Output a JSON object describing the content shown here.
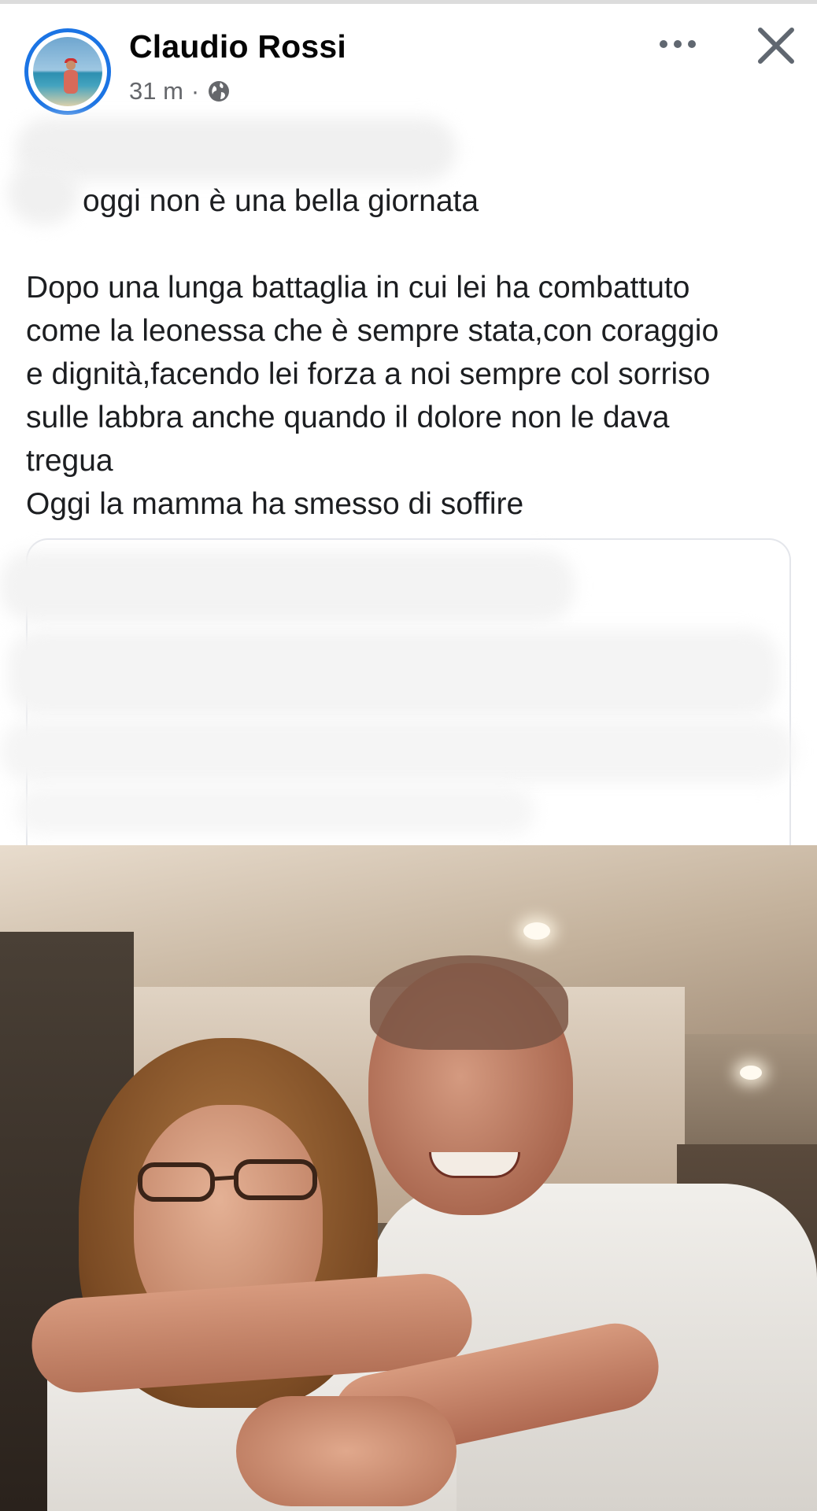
{
  "post": {
    "author": "Claudio Rossi",
    "time": "31 m",
    "separator": "·",
    "audience_icon": "globe-icon",
    "first_line": "oggi non è una bella giornata",
    "body": [
      "Dopo una lunga battaglia in cui lei ha combattuto",
      "come la leonessa che è sempre stata,con coraggio",
      "e dignità,facendo lei forza a noi sempre col sorriso",
      "sulle labbra anche quando il dolore non le dava",
      "tregua",
      "Oggi la mamma ha smesso di soffire"
    ]
  },
  "icons": {
    "more": "more-options-icon",
    "close": "close-icon"
  },
  "colors": {
    "avatar_ring": "#1b74e4",
    "meta_text": "#65676b",
    "icon": "#606770"
  }
}
